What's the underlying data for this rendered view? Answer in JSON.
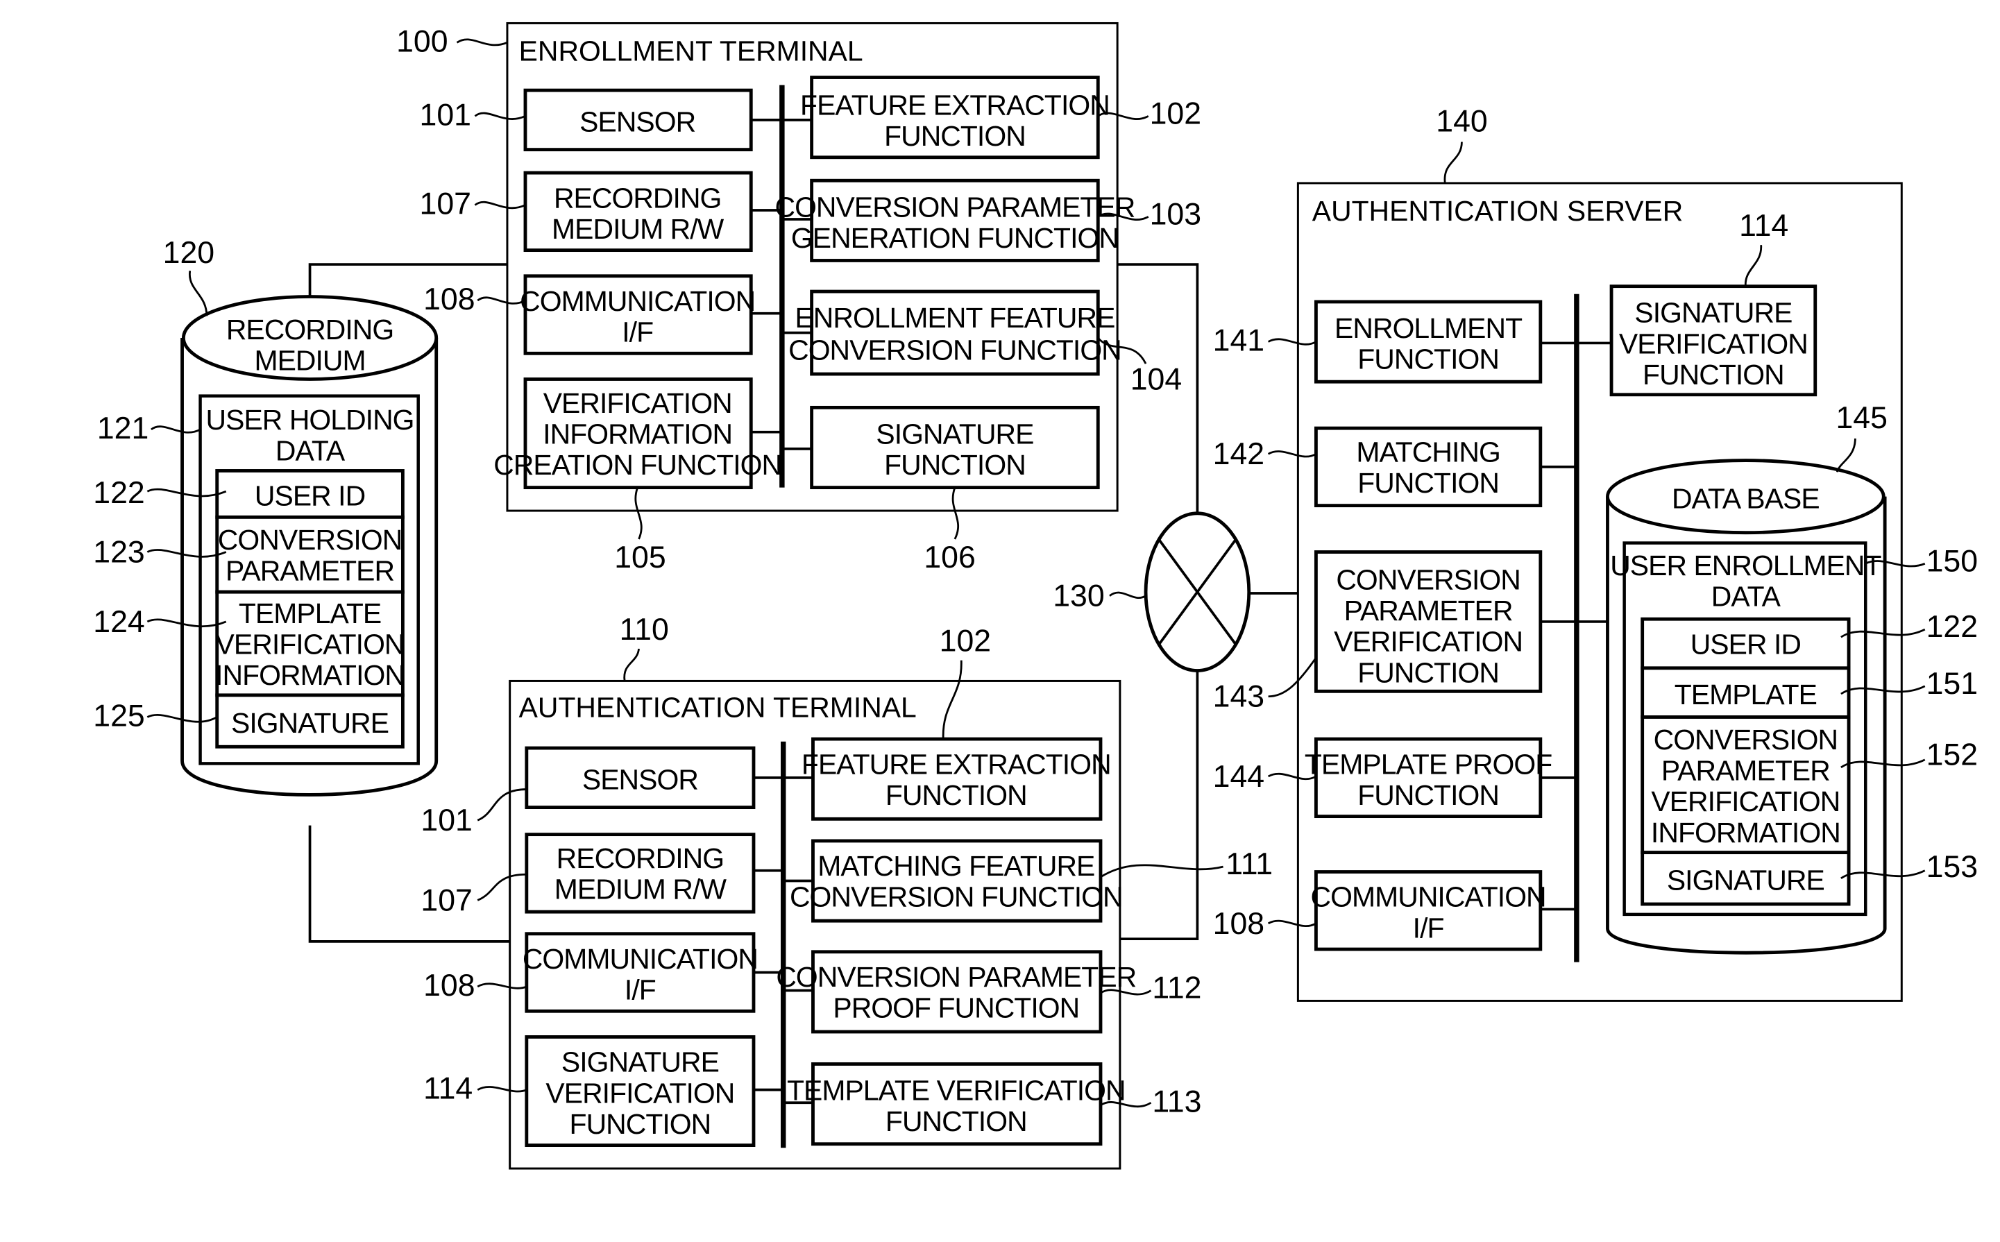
{
  "enrollment_terminal": {
    "ref": "100",
    "title": "ENROLLMENT TERMINAL",
    "blocks": [
      {
        "ref": "101",
        "lines": [
          "SENSOR"
        ]
      },
      {
        "ref": "107",
        "lines": [
          "RECORDING",
          "MEDIUM R/W"
        ]
      },
      {
        "ref": "108",
        "lines": [
          "COMMUNICATION",
          "I/F"
        ]
      },
      {
        "ref": "105",
        "lines": [
          "VERIFICATION",
          "INFORMATION",
          "CREATION FUNCTION"
        ]
      },
      {
        "ref": "102",
        "lines": [
          "FEATURE EXTRACTION",
          "FUNCTION"
        ]
      },
      {
        "ref": "103",
        "lines": [
          "CONVERSION PARAMETER",
          "GENERATION FUNCTION"
        ]
      },
      {
        "ref": "104",
        "lines": [
          "ENROLLMENT FEATURE",
          "CONVERSION FUNCTION"
        ]
      },
      {
        "ref": "106",
        "lines": [
          "SIGNATURE",
          "FUNCTION"
        ]
      }
    ]
  },
  "authentication_terminal": {
    "ref": "110",
    "title": "AUTHENTICATION TERMINAL",
    "blocks": [
      {
        "ref": "101",
        "lines": [
          "SENSOR"
        ]
      },
      {
        "ref": "107",
        "lines": [
          "RECORDING",
          "MEDIUM R/W"
        ]
      },
      {
        "ref": "108",
        "lines": [
          "COMMUNICATION",
          "I/F"
        ]
      },
      {
        "ref": "114",
        "lines": [
          "SIGNATURE",
          "VERIFICATION",
          "FUNCTION"
        ]
      },
      {
        "ref": "102",
        "lines": [
          "FEATURE EXTRACTION",
          "FUNCTION"
        ]
      },
      {
        "ref": "111",
        "lines": [
          "MATCHING FEATURE",
          "CONVERSION FUNCTION"
        ]
      },
      {
        "ref": "112",
        "lines": [
          "CONVERSION PARAMETER",
          "PROOF FUNCTION"
        ]
      },
      {
        "ref": "113",
        "lines": [
          "TEMPLATE VERIFICATION",
          "FUNCTION"
        ]
      }
    ]
  },
  "recording_medium": {
    "ref": "120",
    "title": [
      "RECORDING",
      "MEDIUM"
    ],
    "user_holding_data": {
      "ref": "121",
      "lines": [
        "USER HOLDING",
        "DATA"
      ]
    },
    "fields": [
      {
        "ref": "122",
        "lines": [
          "USER ID"
        ]
      },
      {
        "ref": "123",
        "lines": [
          "CONVERSION",
          "PARAMETER"
        ]
      },
      {
        "ref": "124",
        "lines": [
          "TEMPLATE",
          "VERIFICATION",
          "INFORMATION"
        ]
      },
      {
        "ref": "125",
        "lines": [
          "SIGNATURE"
        ]
      }
    ]
  },
  "network": {
    "ref": "130"
  },
  "authentication_server": {
    "ref": "140",
    "title": "AUTHENTICATION SERVER",
    "blocks": [
      {
        "ref": "141",
        "lines": [
          "ENROLLMENT",
          "FUNCTION"
        ]
      },
      {
        "ref": "142",
        "lines": [
          "MATCHING",
          "FUNCTION"
        ]
      },
      {
        "ref": "143",
        "lines": [
          "CONVERSION",
          "PARAMETER",
          "VERIFICATION",
          "FUNCTION"
        ]
      },
      {
        "ref": "144",
        "lines": [
          "TEMPLATE PROOF",
          "FUNCTION"
        ]
      },
      {
        "ref": "108",
        "lines": [
          "COMMUNICATION",
          "I/F"
        ]
      },
      {
        "ref": "114",
        "lines": [
          "SIGNATURE",
          "VERIFICATION",
          "FUNCTION"
        ]
      }
    ],
    "database": {
      "ref": "145",
      "title": "DATA BASE",
      "user_enrollment_data": {
        "ref": "150",
        "lines": [
          "USER ENROLLMENT",
          "DATA"
        ]
      },
      "fields": [
        {
          "ref": "122",
          "lines": [
            "USER ID"
          ]
        },
        {
          "ref": "151",
          "lines": [
            "TEMPLATE"
          ]
        },
        {
          "ref": "152",
          "lines": [
            "CONVERSION",
            "PARAMETER",
            "VERIFICATION",
            "INFORMATION"
          ]
        },
        {
          "ref": "153",
          "lines": [
            "SIGNATURE"
          ]
        }
      ]
    }
  }
}
